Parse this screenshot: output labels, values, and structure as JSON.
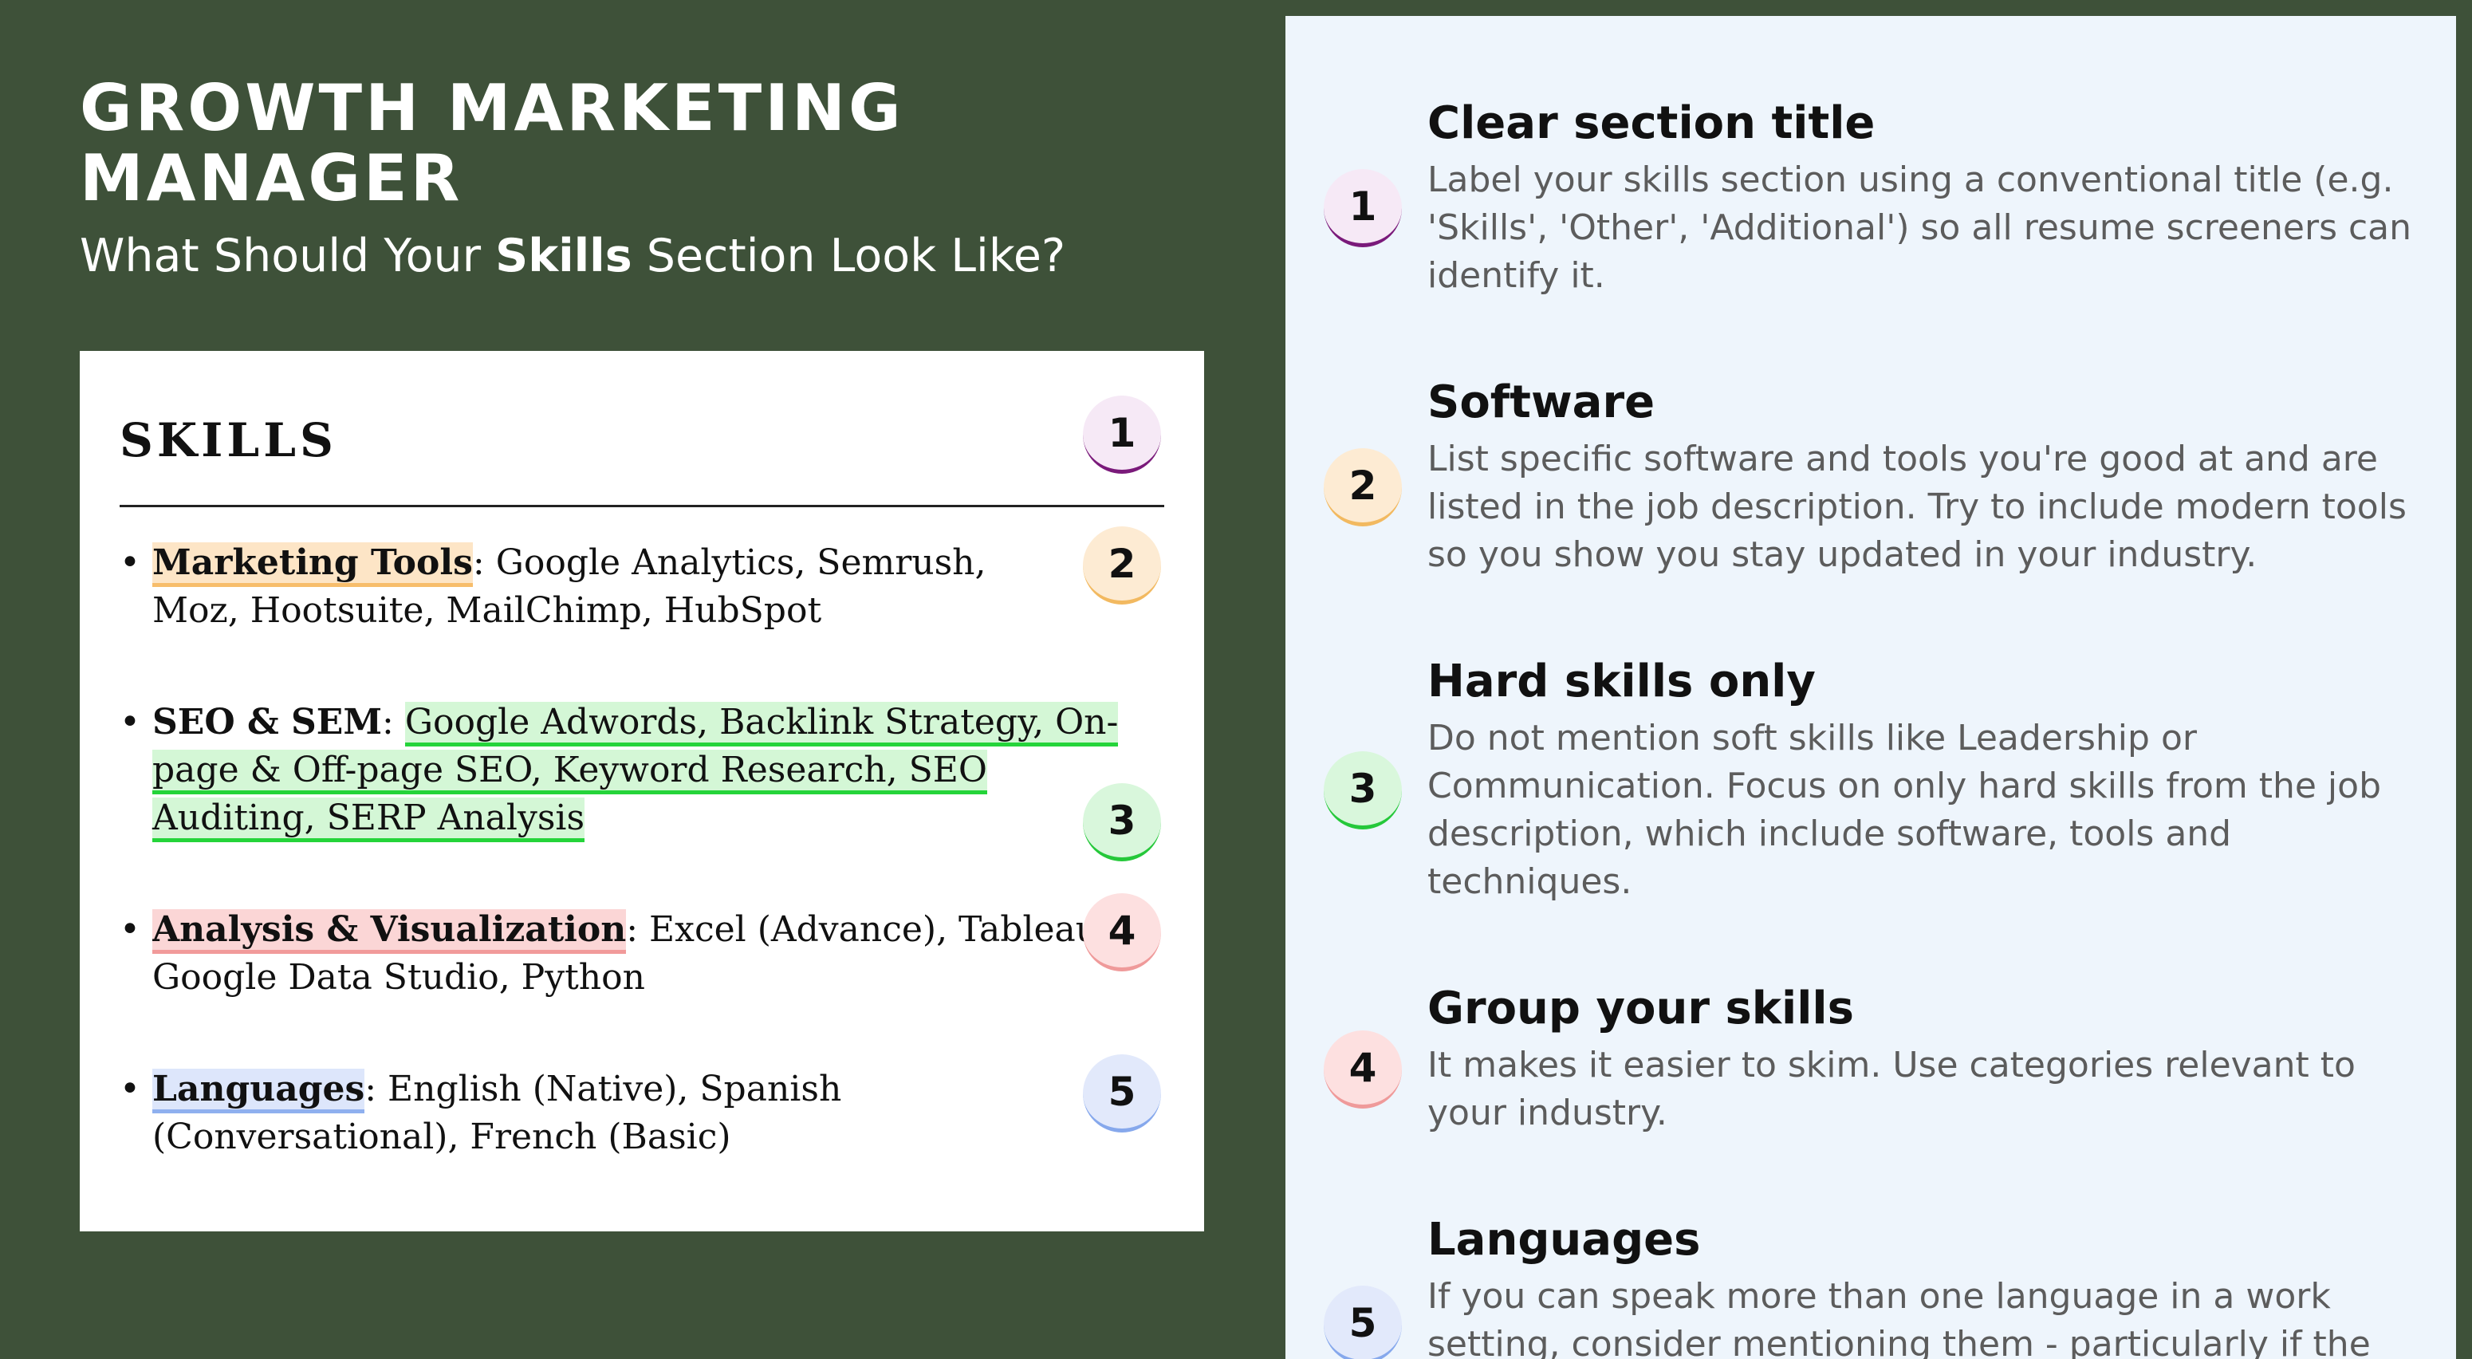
{
  "header": {
    "title_line1": "GROWTH MARKETING",
    "title_line2": "MANAGER",
    "subtitle_pre": "What Should Your ",
    "subtitle_bold": "Skills",
    "subtitle_post": " Section Look Like?"
  },
  "resume": {
    "heading": "SKILLS",
    "bullet": "•",
    "items": [
      {
        "name": "Marketing Tools",
        "sep": ":",
        "rest": " Google Analytics, Semrush, Moz, Hootsuite, MailChimp, HubSpot"
      },
      {
        "name": "SEO & SEM",
        "sep": ":",
        "rest": " ",
        "highlighted": "Google Adwords, Backlink Strategy, On-page & Off-page SEO, Keyword Research, SEO Auditing, SERP Analysis"
      },
      {
        "name": "Analysis & Visualization",
        "sep": ":",
        "rest_line1": " Excel (Advance), Tableau, SPSS,",
        "rest_line2": "Google Data Studio, Python"
      },
      {
        "name": "Languages",
        "sep": ":",
        "rest": " English (Native), Spanish (Conversational), French (Basic)"
      }
    ]
  },
  "badges": [
    "1",
    "2",
    "3",
    "4",
    "5"
  ],
  "tips": [
    {
      "title": "Clear section title",
      "body": "Label your skills section using a conventional title (e.g. 'Skills', 'Other', 'Additional') so all resume screeners can identify it."
    },
    {
      "title": "Software",
      "body": "List specific software and tools you're good at and are listed in the job description. Try to include modern tools so you show you stay updated in your industry."
    },
    {
      "title": "Hard skills only",
      "body": "Do not mention soft skills like Leadership or Communication. Focus on only hard skills from the job description, which include software, tools and techniques."
    },
    {
      "title": "Group your skills",
      "body": "It makes it easier to skim. Use categories relevant to your industry."
    },
    {
      "title": "Languages",
      "body": "If you can speak more than one language in a work setting, consider mentioning them - particularly if the job"
    }
  ],
  "colors": {
    "background": "#3e5139",
    "panel": "#eef5fc",
    "badge_1_accent": "#7a1a7a",
    "badge_2_accent": "#f2b960",
    "badge_3_accent": "#25c83a",
    "badge_4_accent": "#ef9a9a",
    "badge_5_accent": "#86a8ec"
  }
}
